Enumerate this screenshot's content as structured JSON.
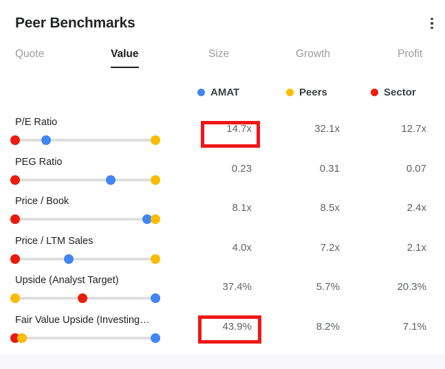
{
  "header": {
    "title": "Peer Benchmarks",
    "menu_icon": "kebab-menu-icon"
  },
  "tabs": [
    {
      "label": "Quote",
      "active": false
    },
    {
      "label": "Value",
      "active": true
    },
    {
      "label": "Size",
      "active": false
    },
    {
      "label": "Growth",
      "active": false
    },
    {
      "label": "Profit",
      "active": false
    }
  ],
  "legend": [
    {
      "label": "AMAT",
      "color": "#4285f4",
      "icon": "blue-dot-icon"
    },
    {
      "label": "Peers",
      "color": "#fbbc04",
      "icon": "amber-dot-icon"
    },
    {
      "label": "Sector",
      "color": "#ea1c0d",
      "icon": "red-dot-icon"
    }
  ],
  "colors": {
    "amat": "#4285f4",
    "peers": "#fbbc04",
    "sector": "#ea1c0d",
    "track": "#dededf",
    "highlight": "#ef1717"
  },
  "rows": [
    {
      "label": "P/E Ratio",
      "values": [
        "14.7x",
        "32.1x",
        "12.7x"
      ],
      "markers": [
        {
          "series": "sector",
          "pos": 0
        },
        {
          "series": "amat",
          "pos": 22
        },
        {
          "series": "peers",
          "pos": 100
        }
      ]
    },
    {
      "label": "PEG Ratio",
      "values": [
        "0.23",
        "0.31",
        "0.07"
      ],
      "markers": [
        {
          "series": "sector",
          "pos": 0
        },
        {
          "series": "amat",
          "pos": 68
        },
        {
          "series": "peers",
          "pos": 100
        }
      ]
    },
    {
      "label": "Price / Book",
      "values": [
        "8.1x",
        "8.5x",
        "2.4x"
      ],
      "markers": [
        {
          "series": "sector",
          "pos": 0
        },
        {
          "series": "amat",
          "pos": 94
        },
        {
          "series": "peers",
          "pos": 100
        }
      ]
    },
    {
      "label": "Price / LTM Sales",
      "values": [
        "4.0x",
        "7.2x",
        "2.1x"
      ],
      "markers": [
        {
          "series": "sector",
          "pos": 0
        },
        {
          "series": "amat",
          "pos": 38
        },
        {
          "series": "peers",
          "pos": 100
        }
      ]
    },
    {
      "label": "Upside (Analyst Target)",
      "values": [
        "37.4%",
        "5.7%",
        "20.3%"
      ],
      "markers": [
        {
          "series": "peers",
          "pos": 0
        },
        {
          "series": "sector",
          "pos": 48
        },
        {
          "series": "amat",
          "pos": 100
        }
      ]
    },
    {
      "label": "Fair Value Upside (Investing…",
      "values": [
        "43.9%",
        "8.2%",
        "7.1%"
      ],
      "markers": [
        {
          "series": "sector",
          "pos": 0
        },
        {
          "series": "peers",
          "pos": 5
        },
        {
          "series": "amat",
          "pos": 100
        }
      ]
    }
  ],
  "chart_data": {
    "type": "table",
    "title": "Peer Benchmarks",
    "categories": [
      "P/E Ratio",
      "PEG Ratio",
      "Price / Book",
      "Price / LTM Sales",
      "Upside (Analyst Target)",
      "Fair Value Upside (Investing…"
    ],
    "series": [
      {
        "name": "AMAT",
        "color": "#4285f4",
        "values": [
          "14.7x",
          "0.23",
          "8.1x",
          "4.0x",
          "37.4%",
          "43.9%"
        ]
      },
      {
        "name": "Peers",
        "color": "#fbbc04",
        "values": [
          "32.1x",
          "0.31",
          "8.5x",
          "7.2x",
          "5.7%",
          "8.2%"
        ]
      },
      {
        "name": "Sector",
        "color": "#ea1c0d",
        "values": [
          "12.7x",
          "0.07",
          "2.4x",
          "2.1x",
          "20.3%",
          "7.1%"
        ]
      }
    ],
    "legend_position": "top",
    "grid": false
  },
  "highlights": [
    {
      "target": "P/E Ratio AMAT",
      "value": "14.7x"
    },
    {
      "target": "Fair Value Upside AMAT",
      "value": "43.9%"
    }
  ]
}
